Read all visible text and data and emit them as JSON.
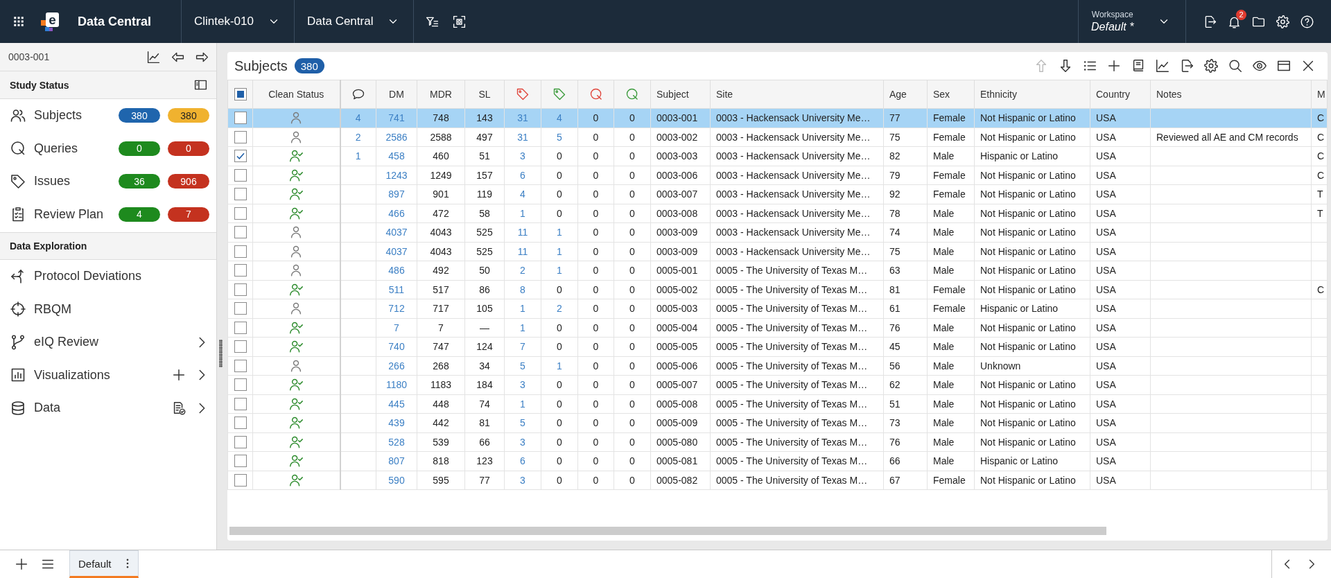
{
  "top_bar": {
    "logo_mark": "e",
    "app_name": "Data Central",
    "study": "Clintek-010",
    "module": "Data Central",
    "workspace": {
      "label": "Workspace",
      "name": "Default",
      "modified_mark": "*"
    },
    "notification_count": "2"
  },
  "sidebar": {
    "subject": "0003-001",
    "sections": [
      {
        "title": "Study Status",
        "panel_toggle": true,
        "items": [
          {
            "label": "Subjects",
            "badges": [
              {
                "text": "380",
                "color": "#1f65ad"
              },
              {
                "text": "380",
                "color": "#f0b22f"
              }
            ]
          },
          {
            "label": "Queries",
            "badges": [
              {
                "text": "0",
                "color": "#1e8a1e"
              },
              {
                "text": "0",
                "color": "#c4321f"
              }
            ]
          },
          {
            "label": "Issues",
            "badges": [
              {
                "text": "36",
                "color": "#1e8a1e"
              },
              {
                "text": "906",
                "color": "#c4321f"
              }
            ]
          },
          {
            "label": "Review Plan",
            "badges": [
              {
                "text": "4",
                "color": "#1e8a1e"
              },
              {
                "text": "7",
                "color": "#c4321f"
              }
            ]
          }
        ]
      },
      {
        "title": "Data Exploration",
        "panel_toggle": false,
        "items": [
          {
            "label": "Protocol Deviations",
            "kind": "plain"
          },
          {
            "label": "RBQM",
            "kind": "plain"
          },
          {
            "label": "eIQ Review",
            "kind": "submenu"
          },
          {
            "label": "Visualizations",
            "kind": "submenu_add"
          },
          {
            "label": "Data",
            "kind": "submenu_report"
          }
        ]
      }
    ]
  },
  "panel": {
    "title": "Subjects",
    "count": "380",
    "up_disabled": true
  },
  "table": {
    "header_checkbox": {
      "indeterminate": true
    },
    "columns": [
      {
        "kind": "status",
        "label": "Clean Status"
      },
      {
        "kind": "comment",
        "link": true
      },
      {
        "kind": "number",
        "label": "DM",
        "link": true
      },
      {
        "kind": "number",
        "label": "MDR",
        "link": false
      },
      {
        "kind": "number",
        "label": "SL",
        "link": false
      },
      {
        "kind": "tag",
        "color": "#e0443a",
        "link": true
      },
      {
        "kind": "tag",
        "color": "#3a9a3a",
        "link": false
      },
      {
        "kind": "query",
        "color": "#e0443a",
        "link": false
      },
      {
        "kind": "query",
        "color": "#3a9a3a",
        "link": false
      },
      {
        "kind": "text",
        "label": "Subject"
      },
      {
        "kind": "text",
        "label": "Site"
      },
      {
        "kind": "text",
        "label": "Age"
      },
      {
        "kind": "text",
        "label": "Sex"
      },
      {
        "kind": "text",
        "label": "Ethnicity"
      },
      {
        "kind": "text",
        "label": "Country"
      },
      {
        "kind": "text",
        "label": "Notes"
      },
      {
        "kind": "text",
        "label": "M"
      }
    ],
    "rows": [
      {
        "selected": true,
        "checked": false,
        "clean": false,
        "green_tag_link": true,
        "cells": [
          null,
          "4",
          "741",
          "748",
          "143",
          "31",
          "4",
          "0",
          "0",
          "0003-001",
          "0003 - Hackensack University Me…",
          "77",
          "Female",
          "Not Hispanic or Latino",
          "USA",
          null,
          "C"
        ]
      },
      {
        "selected": false,
        "checked": false,
        "clean": false,
        "green_tag_link": true,
        "cells": [
          null,
          "2",
          "2586",
          "2588",
          "497",
          "31",
          "5",
          "0",
          "0",
          "0003-002",
          "0003 - Hackensack University Me…",
          "75",
          "Female",
          "Not Hispanic or Latino",
          "USA",
          "Reviewed all AE and CM records",
          "C"
        ]
      },
      {
        "selected": false,
        "checked": true,
        "clean": true,
        "green_tag_link": false,
        "cells": [
          null,
          "1",
          "458",
          "460",
          "51",
          "3",
          "0",
          "0",
          "0",
          "0003-003",
          "0003 - Hackensack University Me…",
          "82",
          "Male",
          "Hispanic or Latino",
          "USA",
          null,
          "C"
        ]
      },
      {
        "selected": false,
        "checked": false,
        "clean": true,
        "green_tag_link": false,
        "cells": [
          null,
          null,
          "1243",
          "1249",
          "157",
          "6",
          "0",
          "0",
          "0",
          "0003-006",
          "0003 - Hackensack University Me…",
          "79",
          "Female",
          "Not Hispanic or Latino",
          "USA",
          null,
          "C"
        ]
      },
      {
        "selected": false,
        "checked": false,
        "clean": true,
        "green_tag_link": false,
        "cells": [
          null,
          null,
          "897",
          "901",
          "119",
          "4",
          "0",
          "0",
          "0",
          "0003-007",
          "0003 - Hackensack University Me…",
          "92",
          "Female",
          "Not Hispanic or Latino",
          "USA",
          null,
          "T"
        ]
      },
      {
        "selected": false,
        "checked": false,
        "clean": true,
        "green_tag_link": false,
        "cells": [
          null,
          null,
          "466",
          "472",
          "58",
          "1",
          "0",
          "0",
          "0",
          "0003-008",
          "0003 - Hackensack University Me…",
          "78",
          "Male",
          "Not Hispanic or Latino",
          "USA",
          null,
          "T"
        ]
      },
      {
        "selected": false,
        "checked": false,
        "clean": false,
        "green_tag_link": true,
        "cells": [
          null,
          null,
          "4037",
          "4043",
          "525",
          "11",
          "1",
          "0",
          "0",
          "0003-009",
          "0003 - Hackensack University Me…",
          "74",
          "Male",
          "Not Hispanic or Latino",
          "USA",
          null,
          null
        ]
      },
      {
        "selected": false,
        "checked": false,
        "clean": false,
        "green_tag_link": true,
        "cells": [
          null,
          null,
          "4037",
          "4043",
          "525",
          "11",
          "1",
          "0",
          "0",
          "0003-009",
          "0003 - Hackensack University Me…",
          "75",
          "Male",
          "Not Hispanic or Latino",
          "USA",
          null,
          null
        ]
      },
      {
        "selected": false,
        "checked": false,
        "clean": false,
        "green_tag_link": true,
        "cells": [
          null,
          null,
          "486",
          "492",
          "50",
          "2",
          "1",
          "0",
          "0",
          "0005-001",
          "0005 - The University of Texas M…",
          "63",
          "Male",
          "Not Hispanic or Latino",
          "USA",
          null,
          null
        ]
      },
      {
        "selected": false,
        "checked": false,
        "clean": true,
        "green_tag_link": false,
        "cells": [
          null,
          null,
          "511",
          "517",
          "86",
          "8",
          "0",
          "0",
          "0",
          "0005-002",
          "0005 - The University of Texas M…",
          "81",
          "Female",
          "Not Hispanic or Latino",
          "USA",
          null,
          "C"
        ]
      },
      {
        "selected": false,
        "checked": false,
        "clean": false,
        "green_tag_link": true,
        "cells": [
          null,
          null,
          "712",
          "717",
          "105",
          "1",
          "2",
          "0",
          "0",
          "0005-003",
          "0005 - The University of Texas M…",
          "61",
          "Female",
          "Hispanic or Latino",
          "USA",
          null,
          null
        ]
      },
      {
        "selected": false,
        "checked": false,
        "clean": true,
        "green_tag_link": false,
        "cells": [
          null,
          null,
          "7",
          "7",
          "—",
          "1",
          "0",
          "0",
          "0",
          "0005-004",
          "0005 - The University of Texas M…",
          "76",
          "Male",
          "Not Hispanic or Latino",
          "USA",
          null,
          null
        ]
      },
      {
        "selected": false,
        "checked": false,
        "clean": true,
        "green_tag_link": false,
        "cells": [
          null,
          null,
          "740",
          "747",
          "124",
          "7",
          "0",
          "0",
          "0",
          "0005-005",
          "0005 - The University of Texas M…",
          "45",
          "Male",
          "Not Hispanic or Latino",
          "USA",
          null,
          null
        ]
      },
      {
        "selected": false,
        "checked": false,
        "clean": false,
        "green_tag_link": true,
        "cells": [
          null,
          null,
          "266",
          "268",
          "34",
          "5",
          "1",
          "0",
          "0",
          "0005-006",
          "0005 - The University of Texas M…",
          "56",
          "Male",
          "Unknown",
          "USA",
          null,
          null
        ]
      },
      {
        "selected": false,
        "checked": false,
        "clean": true,
        "green_tag_link": false,
        "cells": [
          null,
          null,
          "1180",
          "1183",
          "184",
          "3",
          "0",
          "0",
          "0",
          "0005-007",
          "0005 - The University of Texas M…",
          "62",
          "Male",
          "Not Hispanic or Latino",
          "USA",
          null,
          null
        ]
      },
      {
        "selected": false,
        "checked": false,
        "clean": true,
        "green_tag_link": false,
        "cells": [
          null,
          null,
          "445",
          "448",
          "74",
          "1",
          "0",
          "0",
          "0",
          "0005-008",
          "0005 - The University of Texas M…",
          "51",
          "Male",
          "Not Hispanic or Latino",
          "USA",
          null,
          null
        ]
      },
      {
        "selected": false,
        "checked": false,
        "clean": true,
        "green_tag_link": false,
        "cells": [
          null,
          null,
          "439",
          "442",
          "81",
          "5",
          "0",
          "0",
          "0",
          "0005-009",
          "0005 - The University of Texas M…",
          "73",
          "Male",
          "Not Hispanic or Latino",
          "USA",
          null,
          null
        ]
      },
      {
        "selected": false,
        "checked": false,
        "clean": true,
        "green_tag_link": false,
        "cells": [
          null,
          null,
          "528",
          "539",
          "66",
          "3",
          "0",
          "0",
          "0",
          "0005-080",
          "0005 - The University of Texas M…",
          "76",
          "Male",
          "Not Hispanic or Latino",
          "USA",
          null,
          null
        ]
      },
      {
        "selected": false,
        "checked": false,
        "clean": true,
        "green_tag_link": false,
        "cells": [
          null,
          null,
          "807",
          "818",
          "123",
          "6",
          "0",
          "0",
          "0",
          "0005-081",
          "0005 - The University of Texas M…",
          "66",
          "Male",
          "Hispanic or Latino",
          "USA",
          null,
          null
        ]
      },
      {
        "selected": false,
        "checked": false,
        "clean": true,
        "green_tag_link": false,
        "cells": [
          null,
          null,
          "590",
          "595",
          "77",
          "3",
          "0",
          "0",
          "0",
          "0005-082",
          "0005 - The University of Texas M…",
          "67",
          "Female",
          "Not Hispanic or Latino",
          "USA",
          null,
          null
        ]
      }
    ]
  },
  "bottom_bar": {
    "tabs": [
      {
        "label": "Default",
        "selected": true
      }
    ]
  }
}
